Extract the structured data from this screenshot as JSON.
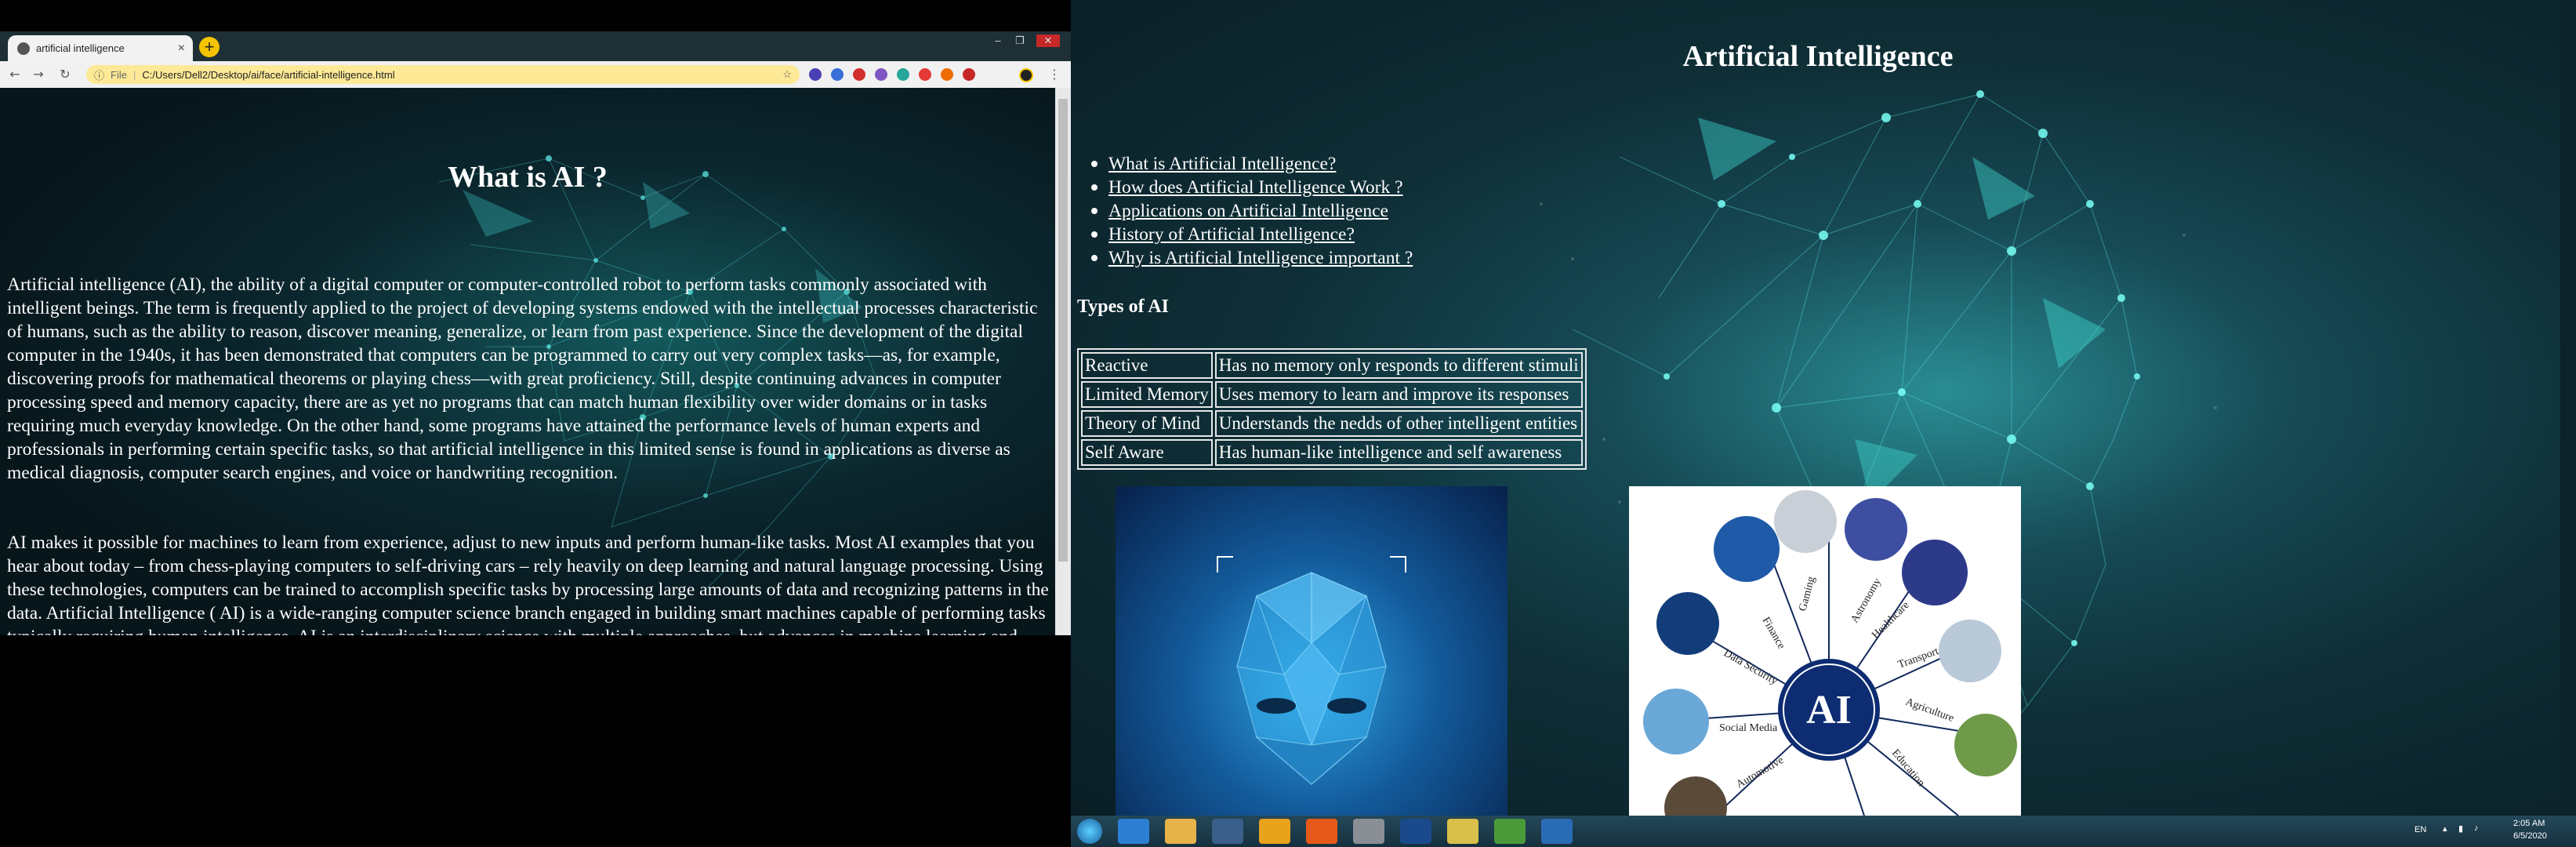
{
  "browser": {
    "tab_title": "artificial intelligence",
    "tab_close": "×",
    "new_tab": "+",
    "url_scheme_label": "File",
    "url": "C:/Users/Dell2/Desktop/ai/face/artificial-intelligence.html",
    "window_controls": [
      "–",
      "❐",
      "✕"
    ]
  },
  "left_page": {
    "heading": "What is AI ?",
    "paragraphs": [
      "Artificial intelligence (AI), the ability of a digital computer or computer-controlled robot to perform tasks commonly associated with intelligent beings. The term is frequently applied to the project of developing systems endowed with the intellectual processes characteristic of humans, such as the ability to reason, discover meaning, generalize, or learn from past experience. Since the development of the digital computer in the 1940s, it has been demonstrated that computers can be programmed to carry out very complex tasks—as, for example, discovering proofs for mathematical theorems or playing chess—with great proficiency. Still, despite continuing advances in computer processing speed and memory capacity, there are as yet no programs that can match human flexibility over wider domains or in tasks requiring much everyday knowledge. On the other hand, some programs have attained the performance levels of human experts and professionals in performing certain specific tasks, so that artificial intelligence in this limited sense is found in applications as diverse as medical diagnosis, computer search engines, and voice or handwriting recognition.",
      "AI makes it possible for machines to learn from experience, adjust to new inputs and perform human-like tasks. Most AI examples that you hear about today – from chess-playing computers to self-driving cars – rely heavily on deep learning and natural language processing. Using these technologies, computers can be trained to accomplish specific tasks by processing large amounts of data and recognizing patterns in the data. Artificial Intelligence ( AI) is a wide-ranging computer science branch engaged in building smart machines capable of performing tasks typically requiring human intelligence. AI is an interdisciplinary science with multiple approaches, but advances in machine learning and deep learning create a paradigm shift in almost every"
    ]
  },
  "right_page": {
    "heading": "Artificial Intelligence",
    "links": [
      "What is Artificial Intelligence?",
      "How does Artificial Intelligence Work ?",
      "Applications on Artificial Intelligence",
      "History of Artificial Intelligence?",
      "Why is Artificial Intelligence important ?"
    ],
    "types_heading": "Types of AI",
    "types_table": [
      [
        "Reactive",
        "Has no memory only responds to different stimuli"
      ],
      [
        "Limited Memory",
        "Uses memory to learn and improve its responses"
      ],
      [
        "Theory of Mind",
        "Understands the nedds of other intelligent entities"
      ],
      [
        "Self Aware",
        "Has human-like intelligence and self awareness"
      ]
    ],
    "ai_diagram": {
      "center_label": "AI",
      "spokes": [
        "Gaming",
        "Astronomy",
        "Healthcare",
        "Transport",
        "Agriculture",
        "Education",
        "Finance",
        "Data Security",
        "Social Media",
        "Automotive"
      ]
    }
  },
  "taskbar": {
    "language": "EN",
    "time": "2:05 AM",
    "date": "6/5/2020"
  }
}
